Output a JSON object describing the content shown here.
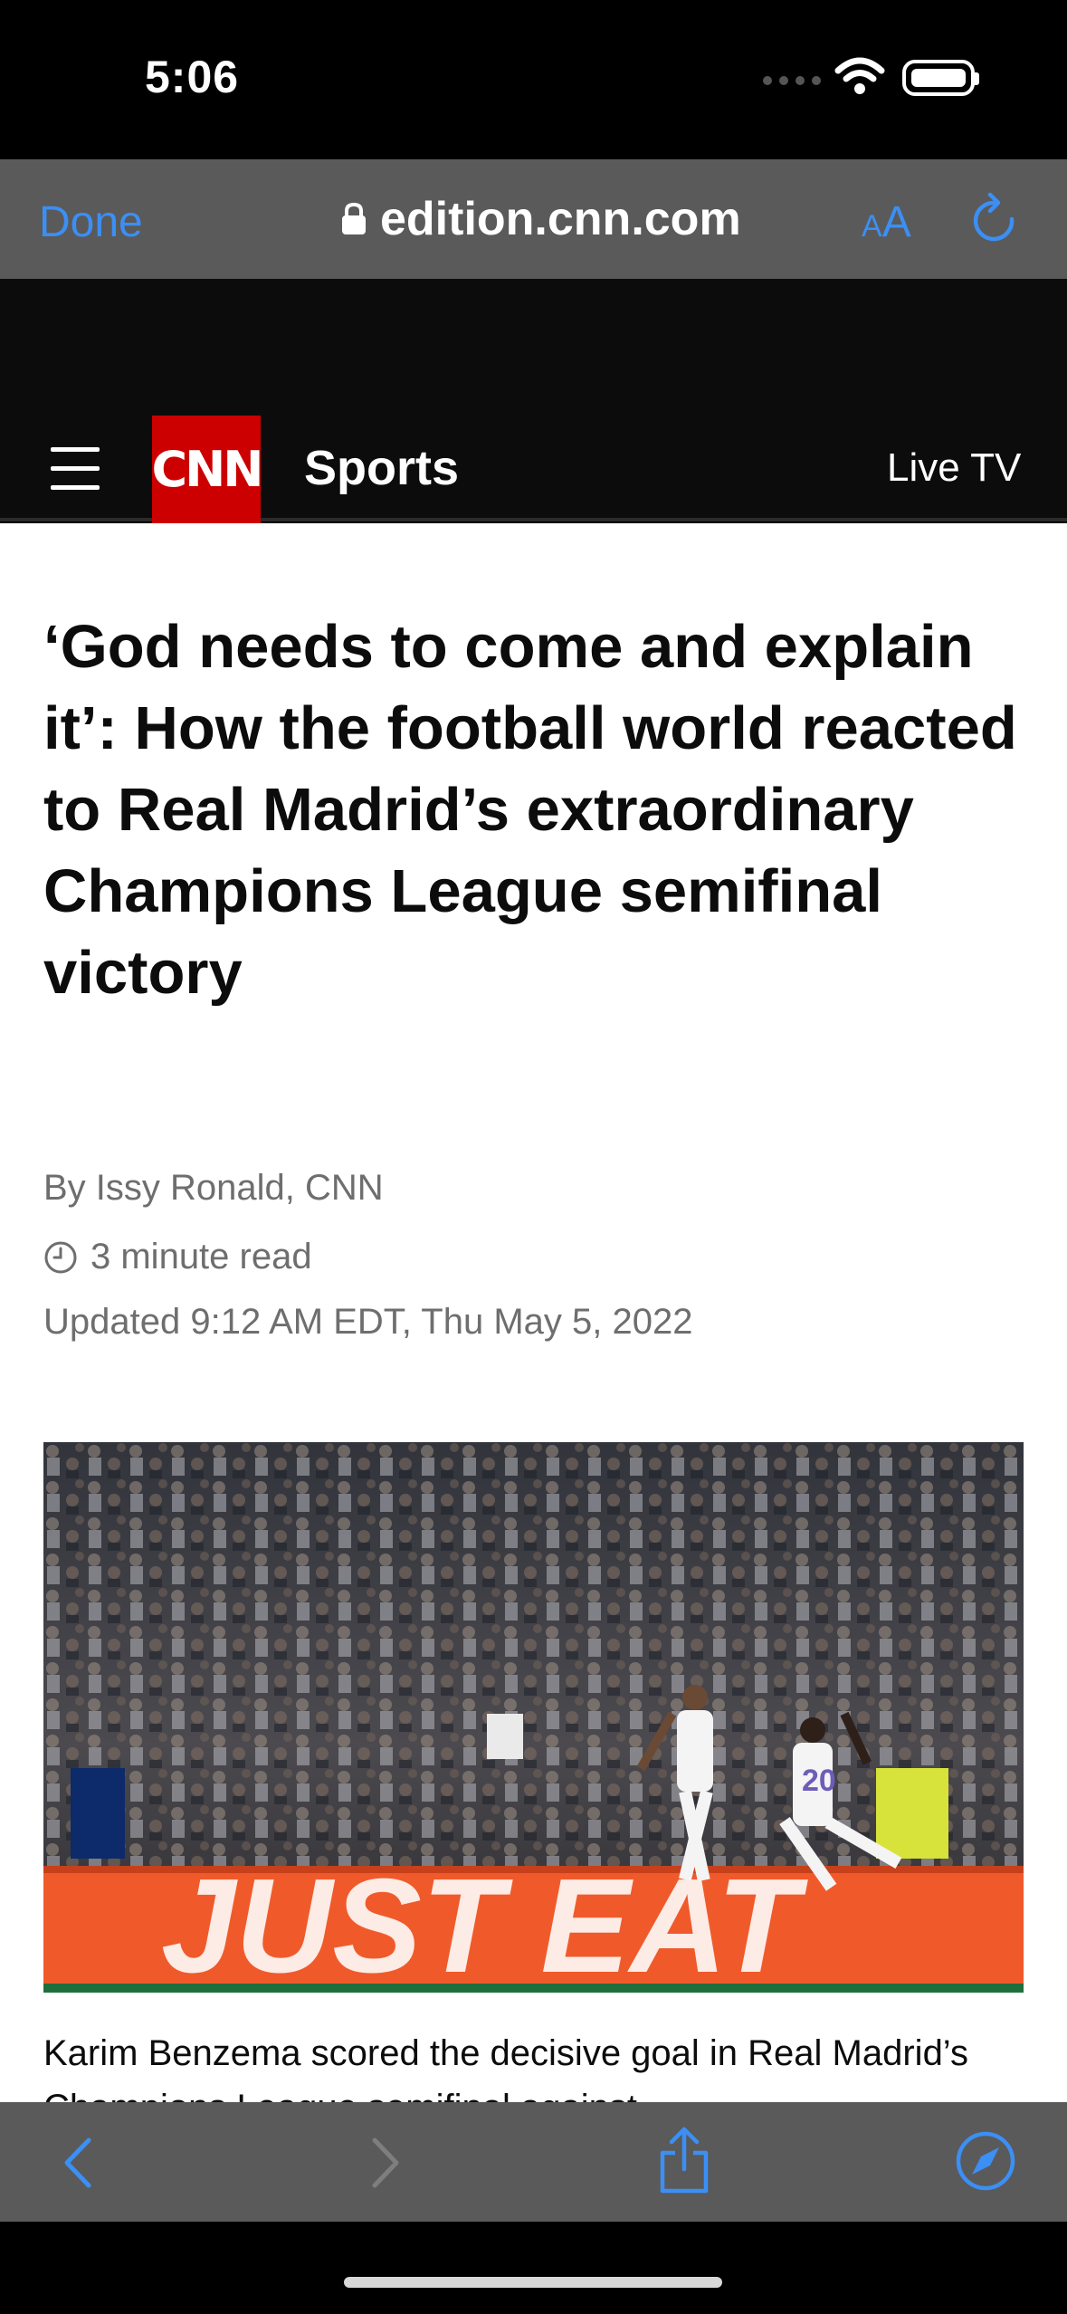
{
  "status_bar": {
    "time": "5:06"
  },
  "browser": {
    "done_label": "Done",
    "url": "edition.cnn.com",
    "text_size_label": "AA",
    "accent_color": "#3b8ff5"
  },
  "site_nav": {
    "logo_text": "CNN",
    "section": "Sports",
    "live_tv": "Live TV",
    "brand_color": "#cc0000"
  },
  "article": {
    "headline": "‘God needs to come and explain it’: How the football world reacted to Real Madrid’s extraordinary Champions League semifinal victory",
    "byline": "By Issy Ronald, CNN",
    "read_time": "3 minute read",
    "updated": "Updated 9:12 AM EDT, Thu May 5, 2022",
    "photo": {
      "board_text": "JUST EAT",
      "jersey_number": "20"
    },
    "caption": "Karim Benzema scored the decisive goal in Real Madrid’s Champions League semifinal against"
  },
  "toolbar": {
    "icons": [
      "back-icon",
      "forward-icon",
      "share-icon",
      "compass-icon"
    ]
  }
}
